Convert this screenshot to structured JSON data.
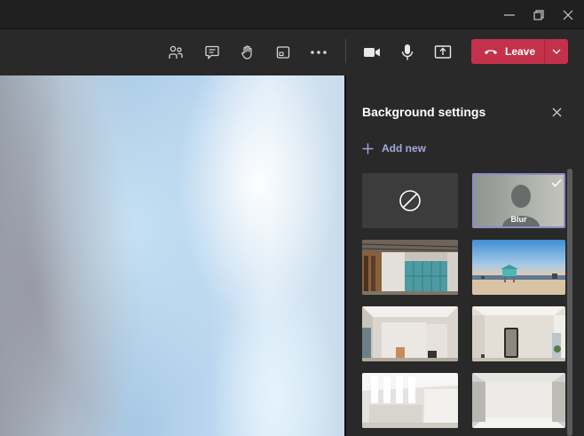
{
  "window": {
    "controls": [
      "minimize-icon",
      "restore-icon",
      "close-icon"
    ]
  },
  "toolbar": {
    "icons": [
      "participants-icon",
      "chat-icon",
      "raise-hand-icon",
      "rooms-icon",
      "more-options-icon",
      "camera-icon",
      "microphone-icon",
      "share-screen-icon"
    ],
    "leave_label": "Leave",
    "leave_color": "#c4314b"
  },
  "background_panel": {
    "title": "Background settings",
    "add_new_label": "Add new",
    "accent_color": "#a6a7dc",
    "options": [
      {
        "id": "none",
        "label": "",
        "icon": "no-background-icon"
      },
      {
        "id": "blur",
        "label": "Blur",
        "selected": true,
        "icon": "checkmark-icon"
      },
      {
        "id": "office-lockers",
        "label": ""
      },
      {
        "id": "beach-lifeguard",
        "label": ""
      },
      {
        "id": "white-room-window",
        "label": ""
      },
      {
        "id": "white-room-mirror",
        "label": ""
      },
      {
        "id": "white-loft",
        "label": ""
      },
      {
        "id": "white-studio",
        "label": ""
      }
    ]
  }
}
